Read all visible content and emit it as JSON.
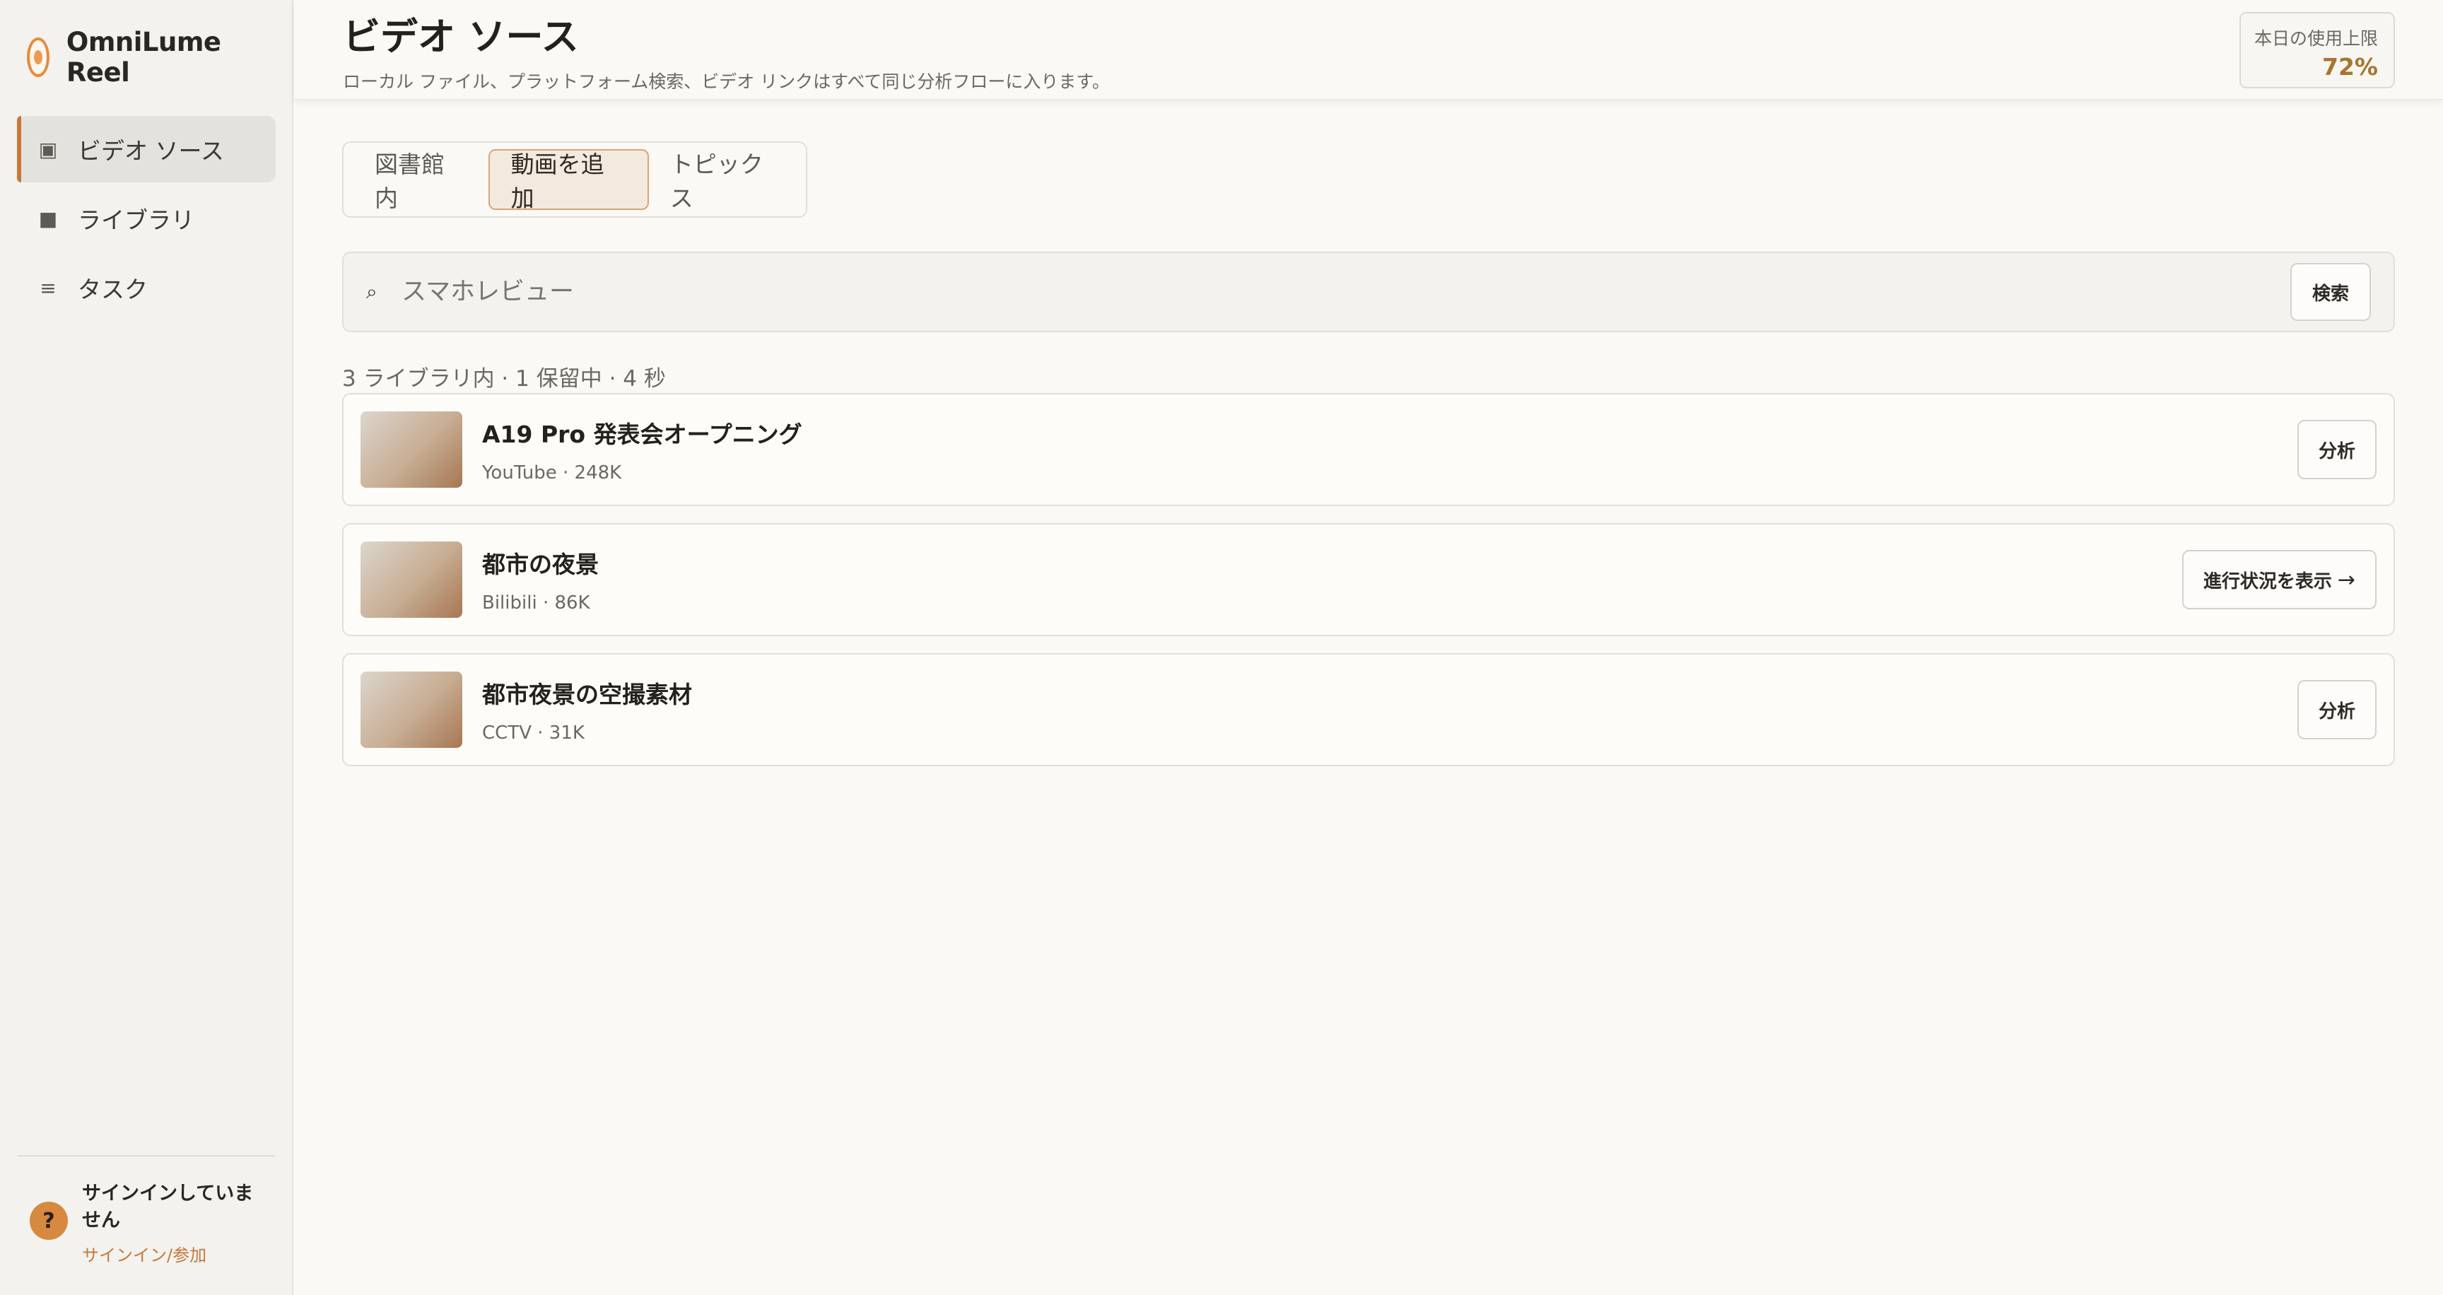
{
  "app": {
    "name": "OmniLume Reel",
    "logo_icon": "orb-logo-icon",
    "accent": "#e8893a"
  },
  "sidebar": {
    "items": [
      {
        "label": "ビデオ ソース",
        "icon": "▣",
        "icon_name": "video-source-icon",
        "active": true
      },
      {
        "label": "ライブラリ",
        "icon": "■",
        "icon_name": "library-icon",
        "active": false
      },
      {
        "label": "タスク",
        "icon": "≡",
        "icon_name": "tasks-icon",
        "active": false
      }
    ],
    "account": {
      "avatar": "?",
      "status": "サインインしていません",
      "signin_link": "サインイン/参加"
    }
  },
  "header": {
    "title": "ビデオ ソース",
    "subtitle": "ローカル ファイル、プラットフォーム検索、ビデオ リンクはすべて同じ分析フローに入ります。",
    "usage": {
      "label": "本日の使用上限",
      "value": "72%"
    }
  },
  "tabs": [
    {
      "label": "図書館内",
      "active": false
    },
    {
      "label": "動画を追加",
      "active": true
    },
    {
      "label": "トピックス",
      "active": false
    }
  ],
  "search": {
    "icon": "⌕",
    "value": "",
    "placeholder": "スマホレビュー",
    "button_label": "検索"
  },
  "results": {
    "summary": "3 ライブラリ内 · 1 保留中 · 4 秒",
    "items": [
      {
        "title": "A19 Pro 発表会オープニング",
        "meta": "YouTube · 248K",
        "action": "分析",
        "arrow": ""
      },
      {
        "title": "都市の夜景",
        "meta": "Bilibili · 86K",
        "action": "進行状況を表示",
        "arrow": "→"
      },
      {
        "title": "都市夜景の空撮素材",
        "meta": "CCTV · 31K",
        "action": "分析",
        "arrow": ""
      }
    ]
  }
}
